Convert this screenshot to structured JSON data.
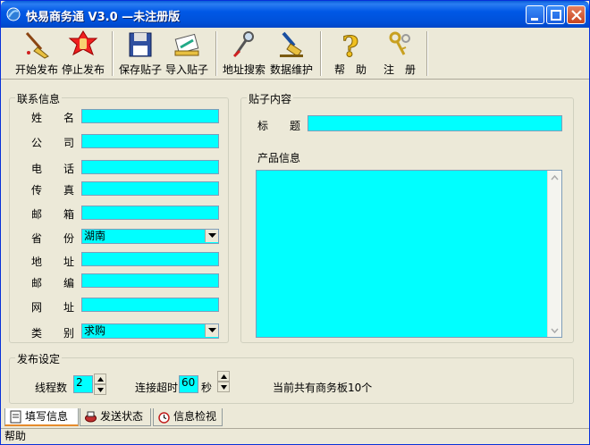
{
  "window": {
    "title": "快易商务通 V3.0 —未注册版"
  },
  "toolbar": {
    "items": [
      {
        "label": "开始发布",
        "icon": "broom-icon"
      },
      {
        "label": "停止发布",
        "icon": "stop-hand-icon"
      },
      {
        "label": "保存贴子",
        "icon": "floppy-disk-icon"
      },
      {
        "label": "导入贴子",
        "icon": "import-icon"
      },
      {
        "label": "地址搜索",
        "icon": "magnifier-icon"
      },
      {
        "label": "数据维护",
        "icon": "data-brush-icon"
      },
      {
        "label": "帮　助",
        "icon": "question-icon"
      },
      {
        "label": "注　册",
        "icon": "keys-icon"
      }
    ]
  },
  "contact": {
    "title": "联系信息",
    "fields": [
      {
        "label": "姓　　名",
        "value": ""
      },
      {
        "label": "公　　司",
        "value": ""
      },
      {
        "label": "电　　话",
        "value": ""
      },
      {
        "label": "传　　真",
        "value": ""
      },
      {
        "label": "邮　　箱",
        "value": ""
      },
      {
        "label": "省　　份",
        "value": "湖南"
      },
      {
        "label": "地　　址",
        "value": ""
      },
      {
        "label": "邮　　编",
        "value": ""
      },
      {
        "label": "网　　址",
        "value": ""
      },
      {
        "label": "类　　别",
        "value": "求购"
      }
    ]
  },
  "post": {
    "title": "贴子内容",
    "title_label": "标　　题",
    "title_value": "",
    "product_label": "产品信息",
    "product_value": ""
  },
  "publish": {
    "title": "发布设定",
    "threads_label": "线程数",
    "threads_value": "2",
    "timeout_label": "连接超时",
    "timeout_value": "60",
    "timeout_unit": "秒",
    "board_count_text": "当前共有商务板10个"
  },
  "tabs": [
    {
      "label": "填写信息",
      "icon": "form-icon",
      "active": true
    },
    {
      "label": "发送状态",
      "icon": "send-icon",
      "active": false
    },
    {
      "label": "信息检视",
      "icon": "alarm-clock-icon",
      "active": false
    }
  ],
  "status": {
    "text": "帮助"
  },
  "colors": {
    "field_bg": "#00ffff",
    "titlebar": "#0058e6",
    "window_bg": "#ece9d8"
  }
}
